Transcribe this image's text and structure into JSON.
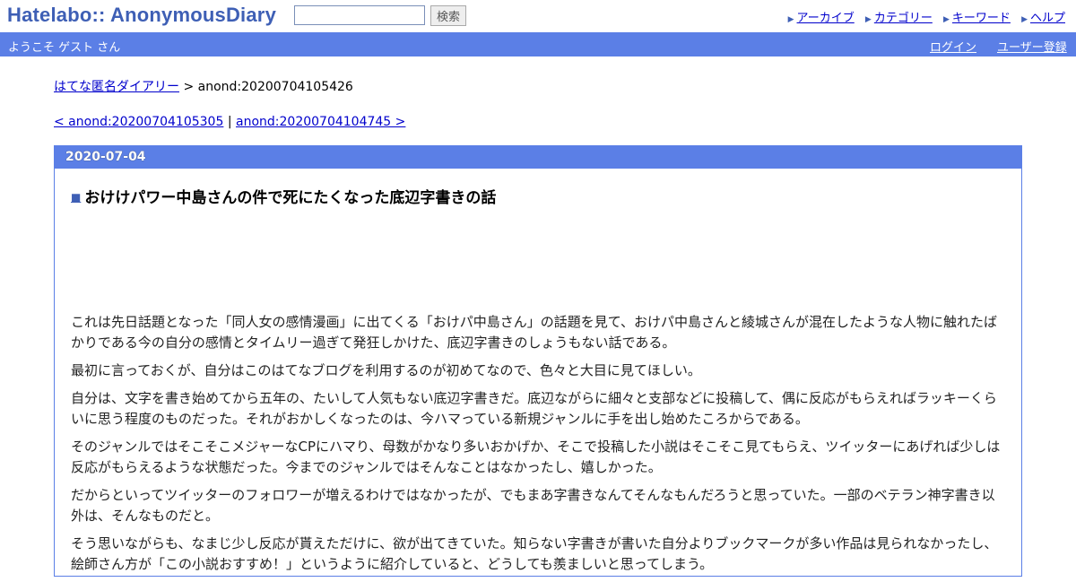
{
  "header": {
    "logo": "Hatelabo:: AnonymousDiary",
    "search": {
      "value": "",
      "button_label": "検索"
    },
    "nav": [
      "アーカイブ",
      "カテゴリー",
      "キーワード",
      "ヘルプ"
    ]
  },
  "welcome_bar": {
    "welcome_text": "ようこそ ゲスト さん",
    "login": "ログイン",
    "register": "ユーザー登録"
  },
  "breadcrumb": {
    "home_link": "はてな匿名ダイアリー",
    "separator": " > ",
    "current": "anond:20200704105426"
  },
  "pager": {
    "prev": "< anond:20200704105305",
    "separator": " | ",
    "next": "anond:20200704104745 >"
  },
  "entry": {
    "date": "2020-07-04",
    "title_marker": "■",
    "title": "おけけパワー中島さんの件で死にたくなった底辺字書きの話",
    "paragraphs": [
      "これは先日話題となった「同人女の感情漫画」に出てくる「おけパ中島さん」の話題を見て、おけパ中島さんと綾城さんが混在したような人物に触れたばかりである今の自分の感情とタイムリー過ぎて発狂しかけた、底辺字書きのしょうもない話である。",
      "最初に言っておくが、自分はこのはてなブログを利用するのが初めてなので、色々と大目に見てほしい。",
      "自分は、文字を書き始めてから五年の、たいして人気もない底辺字書きだ。底辺ながらに細々と支部などに投稿して、偶に反応がもらえればラッキーくらいに思う程度のものだった。それがおかしくなったのは、今ハマっている新規ジャンルに手を出し始めたころからである。",
      "そのジャンルではそこそこメジャーなCPにハマり、母数がかなり多いおかげか、そこで投稿した小説はそこそこ見てもらえ、ツイッターにあげれば少しは反応がもらえるような状態だった。今までのジャンルではそんなことはなかったし、嬉しかった。",
      "だからといってツイッターのフォロワーが増えるわけではなかったが、でもまあ字書きなんてそんなもんだろうと思っていた。一部のベテラン神字書き以外は、そんなものだと。",
      "そう思いながらも、なまじ少し反応が貰えただけに、欲が出てきていた。知らない字書きが書いた自分よりブックマークが多い作品は見られなかったし、絵師さん方が「この小説おすすめ！」というように紹介していると、どうしても羨ましいと思ってしまう。"
    ]
  }
}
